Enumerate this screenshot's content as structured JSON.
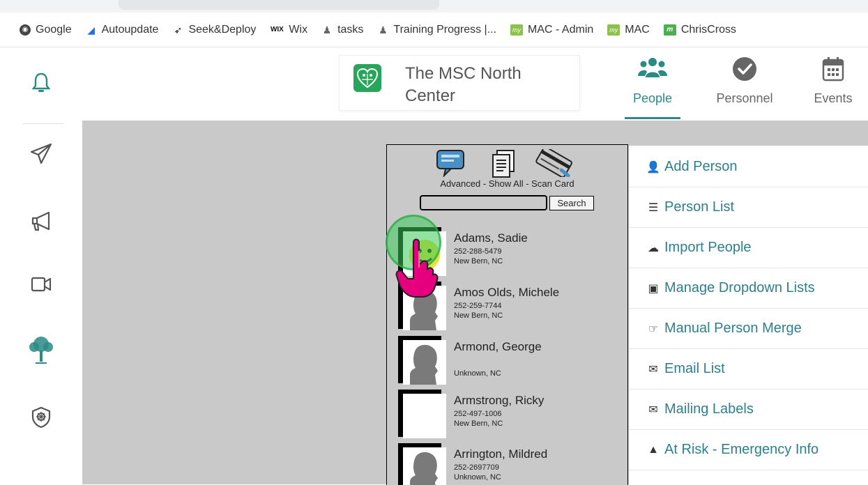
{
  "bookmarks": [
    {
      "label": "Google",
      "icon": "google-icon"
    },
    {
      "label": "Autoupdate",
      "icon": "shield-icon"
    },
    {
      "label": "Seek&Deploy",
      "icon": "rocket-icon"
    },
    {
      "label": "Wix",
      "icon": "wix-icon",
      "icon_text": "WIX"
    },
    {
      "label": "tasks",
      "icon": "tasks-icon"
    },
    {
      "label": "Training Progress |...",
      "icon": "tasks-icon"
    },
    {
      "label": "MAC - Admin",
      "icon": "my-icon",
      "icon_text": "my"
    },
    {
      "label": "MAC",
      "icon": "my-icon",
      "icon_text": "my"
    },
    {
      "label": "ChrisCross",
      "icon": "mm-icon",
      "icon_text": "m"
    }
  ],
  "sidebar": {
    "items": [
      "bell-icon",
      "paper-plane-icon",
      "megaphone-icon",
      "video-icon",
      "tree-icon",
      "shield-badge-icon"
    ],
    "accent": "#2a8a86"
  },
  "header": {
    "org_name": "The MSC North Center",
    "tabs": [
      {
        "label": "People",
        "icon": "people-icon",
        "active": true
      },
      {
        "label": "Personnel",
        "icon": "check-circle-icon",
        "active": false
      },
      {
        "label": "Events",
        "icon": "calendar-icon",
        "active": false
      }
    ]
  },
  "people_panel": {
    "tools_caption": "Advanced - Show All - Scan Card",
    "search_value": "",
    "search_button": "Search",
    "people": [
      {
        "name": "Adams, Sadie",
        "phone": "252-288-5479",
        "city": "New Bern, NC",
        "photo": "smiley"
      },
      {
        "name": "Amos Olds, Michele",
        "phone": "252-259-7744",
        "city": "New Bern, NC",
        "photo": "silhouette"
      },
      {
        "name": "Armond, George",
        "phone": "",
        "city": "Unknown, NC",
        "photo": "silhouette"
      },
      {
        "name": "Armstrong, Ricky",
        "phone": "252-497-1006",
        "city": "New Bern, NC",
        "photo": "blank"
      },
      {
        "name": "Arrington, Mildred",
        "phone": "252-2697709",
        "city": "Unknown, NC",
        "photo": "silhouette"
      }
    ]
  },
  "menu": {
    "items": [
      {
        "label": "Add Person",
        "icon": "add-user-icon"
      },
      {
        "label": "Person List",
        "icon": "list-icon"
      },
      {
        "label": "Import People",
        "icon": "cloud-upload-icon"
      },
      {
        "label": "Manage Dropdown Lists",
        "icon": "dropdown-icon"
      },
      {
        "label": "Manual Person Merge",
        "icon": "hand-point-icon"
      },
      {
        "label": "Email List",
        "icon": "envelope-icon"
      },
      {
        "label": "Mailing Labels",
        "icon": "envelope-outline-icon"
      },
      {
        "label": "At Risk - Emergency Info",
        "icon": "warning-icon"
      }
    ]
  }
}
